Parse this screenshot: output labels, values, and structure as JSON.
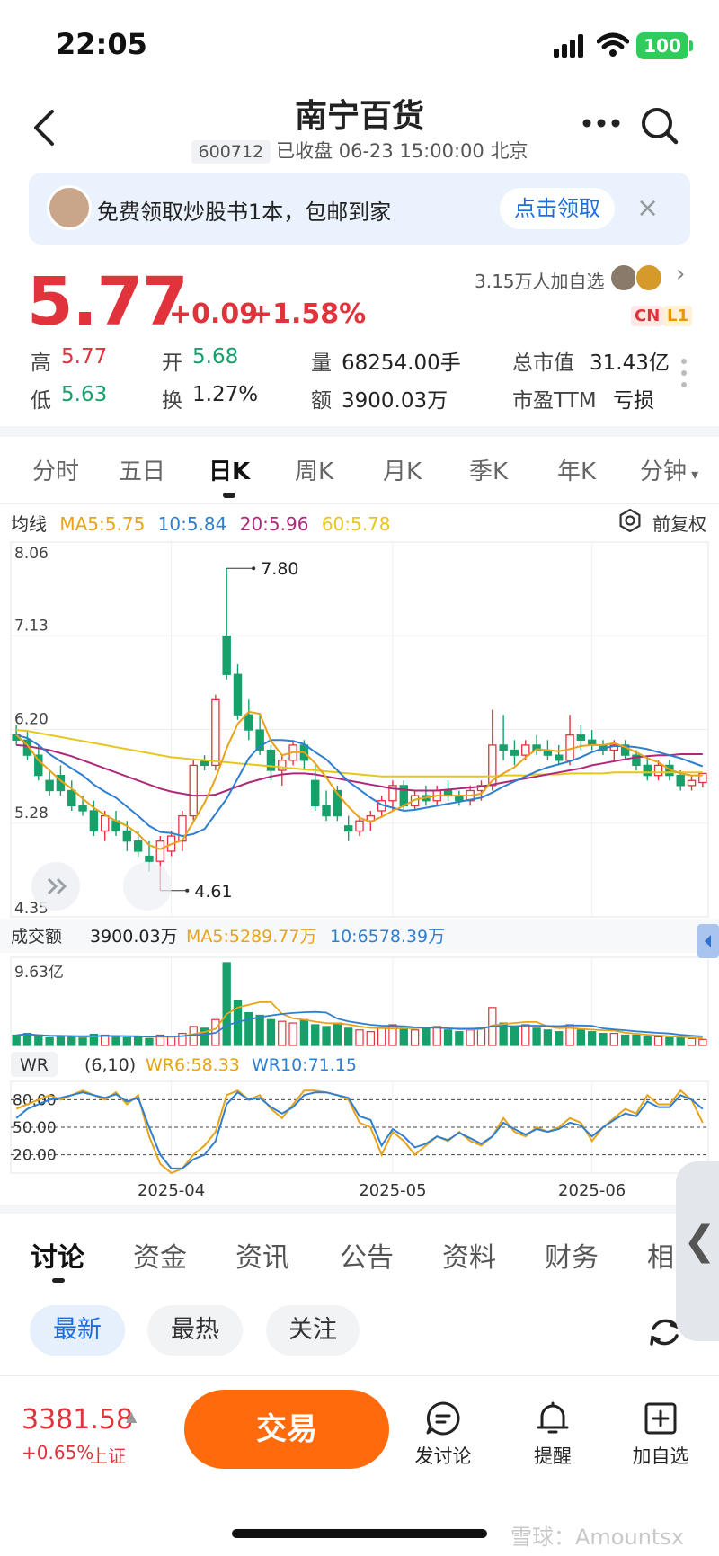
{
  "status": {
    "time": "22:05",
    "battery": "100"
  },
  "header": {
    "title": "南宁百货",
    "code": "600712",
    "status_text": "已收盘 06-23 15:00:00 北京"
  },
  "banner": {
    "text": "免费领取炒股书1本，包邮到家",
    "button": "点击领取",
    "close": "×"
  },
  "quote": {
    "price": "5.77",
    "change": "+0.09",
    "change_pct": "+1.58%",
    "followers": "3.15万人加自选",
    "tags": [
      "CN",
      "L1"
    ],
    "stats": {
      "high_label": "高",
      "high": "5.77",
      "open_label": "开",
      "open": "5.68",
      "volume_label": "量",
      "volume": "68254.00手",
      "mcap_label": "总市值",
      "mcap": "31.43亿",
      "low_label": "低",
      "low": "5.63",
      "turnover_label": "换",
      "turnover": "1.27%",
      "amount_label": "额",
      "amount": "3900.03万",
      "pe_label": "市盈TTM",
      "pe": "亏损"
    }
  },
  "period_tabs": [
    "分时",
    "五日",
    "日K",
    "周K",
    "月K",
    "季K",
    "年K",
    "分钟"
  ],
  "active_period": "日K",
  "ma_legend": {
    "title": "均线",
    "ma5": "MA5:5.75",
    "ma10": "10:5.84",
    "ma20": "20:5.96",
    "ma60": "60:5.78",
    "adjust": "前复权"
  },
  "colors": {
    "up": "#e0333c",
    "down": "#17a06a",
    "ma5": "#e8a317",
    "ma10": "#2f7fd0",
    "ma20": "#b0287a",
    "ma60": "#e6c619"
  },
  "chart_data": {
    "type": "candlestick",
    "price_axis": {
      "ticks": [
        "8.06",
        "7.13",
        "6.20",
        "5.28",
        "4.35"
      ],
      "ylim": [
        4.35,
        8.06
      ]
    },
    "annotations": {
      "high": "7.80",
      "low": "4.61"
    },
    "x_labels": [
      "2025-04",
      "2025-05",
      "2025-06"
    ],
    "candles": [
      [
        6.15,
        6.25,
        6.05,
        6.1
      ],
      [
        6.1,
        6.2,
        5.9,
        5.95
      ],
      [
        5.95,
        6.05,
        5.7,
        5.75
      ],
      [
        5.7,
        5.8,
        5.55,
        5.6
      ],
      [
        5.75,
        5.85,
        5.55,
        5.6
      ],
      [
        5.6,
        5.7,
        5.4,
        5.45
      ],
      [
        5.45,
        5.55,
        5.35,
        5.4
      ],
      [
        5.4,
        5.5,
        5.15,
        5.2
      ],
      [
        5.2,
        5.4,
        5.1,
        5.35
      ],
      [
        5.3,
        5.4,
        5.15,
        5.2
      ],
      [
        5.2,
        5.3,
        5.0,
        5.1
      ],
      [
        5.1,
        5.2,
        4.95,
        5.0
      ],
      [
        4.95,
        5.1,
        4.8,
        4.9
      ],
      [
        4.9,
        5.15,
        4.61,
        5.1
      ],
      [
        5.0,
        5.2,
        4.95,
        5.15
      ],
      [
        5.1,
        5.4,
        5.0,
        5.35
      ],
      [
        5.35,
        5.9,
        5.3,
        5.85
      ],
      [
        5.9,
        5.95,
        5.8,
        5.85
      ],
      [
        5.85,
        6.55,
        5.8,
        6.5
      ],
      [
        7.13,
        7.8,
        6.7,
        6.75
      ],
      [
        6.75,
        6.85,
        6.3,
        6.35
      ],
      [
        6.35,
        6.5,
        6.1,
        6.2
      ],
      [
        6.2,
        6.35,
        5.95,
        6.0
      ],
      [
        6.0,
        6.05,
        5.7,
        5.8
      ],
      [
        5.8,
        5.95,
        5.65,
        5.9
      ],
      [
        5.9,
        6.1,
        5.85,
        6.05
      ],
      [
        6.05,
        6.1,
        5.8,
        5.9
      ],
      [
        5.7,
        5.85,
        5.4,
        5.45
      ],
      [
        5.45,
        5.6,
        5.3,
        5.35
      ],
      [
        5.6,
        5.65,
        5.3,
        5.35
      ],
      [
        5.25,
        5.35,
        5.1,
        5.2
      ],
      [
        5.2,
        5.35,
        5.15,
        5.3
      ],
      [
        5.3,
        5.4,
        5.2,
        5.35
      ],
      [
        5.4,
        5.55,
        5.35,
        5.5
      ],
      [
        5.5,
        5.7,
        5.4,
        5.65
      ],
      [
        5.65,
        5.7,
        5.4,
        5.45
      ],
      [
        5.45,
        5.6,
        5.4,
        5.55
      ],
      [
        5.55,
        5.65,
        5.45,
        5.5
      ],
      [
        5.5,
        5.65,
        5.45,
        5.6
      ],
      [
        5.6,
        5.7,
        5.5,
        5.55
      ],
      [
        5.55,
        5.6,
        5.45,
        5.5
      ],
      [
        5.5,
        5.65,
        5.45,
        5.6
      ],
      [
        5.6,
        5.7,
        5.5,
        5.65
      ],
      [
        5.65,
        6.4,
        5.6,
        6.05
      ],
      [
        6.05,
        6.35,
        5.9,
        6.0
      ],
      [
        6.0,
        6.1,
        5.85,
        5.95
      ],
      [
        5.95,
        6.1,
        5.9,
        6.05
      ],
      [
        6.05,
        6.15,
        5.95,
        6.0
      ],
      [
        6.0,
        6.1,
        5.9,
        5.95
      ],
      [
        5.95,
        6.05,
        5.85,
        5.9
      ],
      [
        5.9,
        6.35,
        5.85,
        6.15
      ],
      [
        6.15,
        6.25,
        6.0,
        6.1
      ],
      [
        6.1,
        6.2,
        6.0,
        6.05
      ],
      [
        6.05,
        6.1,
        5.95,
        6.0
      ],
      [
        6.0,
        6.1,
        5.9,
        6.05
      ],
      [
        6.05,
        6.1,
        5.9,
        5.95
      ],
      [
        5.95,
        6.0,
        5.8,
        5.85
      ],
      [
        5.85,
        5.95,
        5.7,
        5.75
      ],
      [
        5.75,
        5.9,
        5.7,
        5.85
      ],
      [
        5.85,
        5.9,
        5.7,
        5.75
      ],
      [
        5.75,
        5.8,
        5.6,
        5.65
      ],
      [
        5.65,
        5.75,
        5.6,
        5.7
      ],
      [
        5.68,
        5.77,
        5.63,
        5.77
      ]
    ],
    "ma": {
      "ma5": [
        6.15,
        6.05,
        5.9,
        5.8,
        5.7,
        5.62,
        5.52,
        5.43,
        5.36,
        5.3,
        5.25,
        5.17,
        5.06,
        5.02,
        5.07,
        5.11,
        5.29,
        5.48,
        5.72,
        6.02,
        6.26,
        6.38,
        6.36,
        6.09,
        5.95,
        5.98,
        5.98,
        5.87,
        5.73,
        5.57,
        5.44,
        5.33,
        5.29,
        5.34,
        5.4,
        5.45,
        5.51,
        5.53,
        5.55,
        5.55,
        5.55,
        5.55,
        5.57,
        5.7,
        5.77,
        5.83,
        5.93,
        6.01,
        6.0,
        5.99,
        6.01,
        6.04,
        6.05,
        6.05,
        6.07,
        6.03,
        5.98,
        5.92,
        5.88,
        5.81,
        5.77,
        5.75,
        5.75
      ],
      "ma10": [
        6.15,
        6.12,
        6.05,
        5.96,
        5.89,
        5.82,
        5.75,
        5.66,
        5.59,
        5.53,
        5.44,
        5.35,
        5.25,
        5.19,
        5.18,
        5.15,
        5.17,
        5.22,
        5.37,
        5.52,
        5.72,
        5.92,
        6.04,
        6.1,
        6.1,
        6.09,
        6.06,
        5.98,
        5.91,
        5.8,
        5.69,
        5.61,
        5.53,
        5.46,
        5.43,
        5.4,
        5.41,
        5.43,
        5.45,
        5.47,
        5.49,
        5.51,
        5.53,
        5.58,
        5.64,
        5.69,
        5.74,
        5.79,
        5.83,
        5.86,
        5.89,
        5.93,
        5.98,
        6.02,
        6.04,
        6.04,
        6.03,
        6.01,
        5.98,
        5.95,
        5.92,
        5.88,
        5.84
      ],
      "ma20": [
        6.05,
        6.04,
        6.02,
        6.0,
        5.97,
        5.94,
        5.9,
        5.86,
        5.82,
        5.78,
        5.74,
        5.7,
        5.66,
        5.62,
        5.59,
        5.57,
        5.55,
        5.55,
        5.56,
        5.6,
        5.64,
        5.68,
        5.71,
        5.74,
        5.76,
        5.77,
        5.77,
        5.76,
        5.74,
        5.72,
        5.7,
        5.68,
        5.66,
        5.64,
        5.62,
        5.61,
        5.6,
        5.6,
        5.6,
        5.61,
        5.62,
        5.63,
        5.64,
        5.66,
        5.68,
        5.7,
        5.72,
        5.74,
        5.76,
        5.78,
        5.8,
        5.82,
        5.85,
        5.87,
        5.89,
        5.91,
        5.93,
        5.94,
        5.95,
        5.95,
        5.96,
        5.96,
        5.96
      ],
      "ma60": [
        6.2,
        6.19,
        6.17,
        6.15,
        6.13,
        6.11,
        6.09,
        6.07,
        6.05,
        6.03,
        6.01,
        5.99,
        5.97,
        5.95,
        5.93,
        5.92,
        5.91,
        5.9,
        5.89,
        5.88,
        5.87,
        5.86,
        5.85,
        5.84,
        5.83,
        5.82,
        5.81,
        5.8,
        5.79,
        5.78,
        5.77,
        5.76,
        5.75,
        5.74,
        5.74,
        5.74,
        5.74,
        5.74,
        5.74,
        5.74,
        5.74,
        5.74,
        5.74,
        5.74,
        5.75,
        5.75,
        5.75,
        5.76,
        5.76,
        5.76,
        5.77,
        5.77,
        5.77,
        5.77,
        5.78,
        5.78,
        5.78,
        5.78,
        5.78,
        5.78,
        5.78,
        5.78,
        5.78
      ]
    },
    "volume_legend": {
      "title": "成交额",
      "value": "3900.03万",
      "ma5": "MA5:5289.77万",
      "ma10": "10:6578.39万",
      "max_label": "9.63亿"
    },
    "volume": [
      12,
      14,
      10,
      9,
      11,
      10,
      9,
      13,
      12,
      11,
      9,
      10,
      8,
      12,
      10,
      14,
      22,
      20,
      30,
      96,
      52,
      38,
      35,
      30,
      28,
      26,
      30,
      24,
      22,
      26,
      20,
      18,
      16,
      20,
      24,
      22,
      18,
      20,
      22,
      18,
      16,
      18,
      20,
      44,
      26,
      22,
      24,
      20,
      18,
      16,
      24,
      18,
      16,
      14,
      14,
      12,
      12,
      10,
      10,
      9,
      9,
      8,
      7
    ],
    "wr_legend": {
      "title": "WR",
      "params": "(6,10)",
      "wr6": "WR6:58.33",
      "wr10": "WR10:71.15"
    },
    "wr_axis": [
      "80.00",
      "50.00",
      "20.00"
    ],
    "wr6": [
      70,
      75,
      80,
      85,
      80,
      85,
      90,
      85,
      80,
      88,
      75,
      85,
      40,
      10,
      0,
      5,
      20,
      30,
      45,
      85,
      90,
      80,
      85,
      70,
      60,
      75,
      90,
      90,
      88,
      85,
      80,
      55,
      50,
      20,
      45,
      35,
      20,
      30,
      40,
      35,
      45,
      35,
      30,
      40,
      60,
      45,
      40,
      50,
      45,
      50,
      60,
      55,
      35,
      50,
      60,
      70,
      65,
      85,
      75,
      75,
      90,
      80,
      55
    ],
    "wr10": [
      60,
      70,
      75,
      80,
      82,
      85,
      88,
      85,
      82,
      86,
      78,
      82,
      50,
      20,
      5,
      5,
      15,
      20,
      35,
      75,
      88,
      80,
      82,
      72,
      65,
      72,
      85,
      88,
      88,
      85,
      82,
      62,
      58,
      30,
      48,
      40,
      28,
      32,
      40,
      36,
      44,
      38,
      32,
      40,
      55,
      48,
      42,
      48,
      45,
      48,
      55,
      52,
      40,
      50,
      58,
      65,
      62,
      78,
      72,
      72,
      85,
      80,
      70
    ],
    "x_tick_index": [
      14,
      34,
      52
    ]
  },
  "bottom_tabs": [
    "讨论",
    "资金",
    "资讯",
    "公告",
    "资料",
    "财务",
    "相"
  ],
  "filter_chips": [
    "最新",
    "最热",
    "关注"
  ],
  "footer": {
    "index_value": "3381.58",
    "index_change": "+0.65%",
    "index_name": "上证",
    "trade": "交易",
    "post": "发讨论",
    "remind": "提醒",
    "add_watch": "加自选"
  },
  "watermark": "雪球：Amountsx"
}
